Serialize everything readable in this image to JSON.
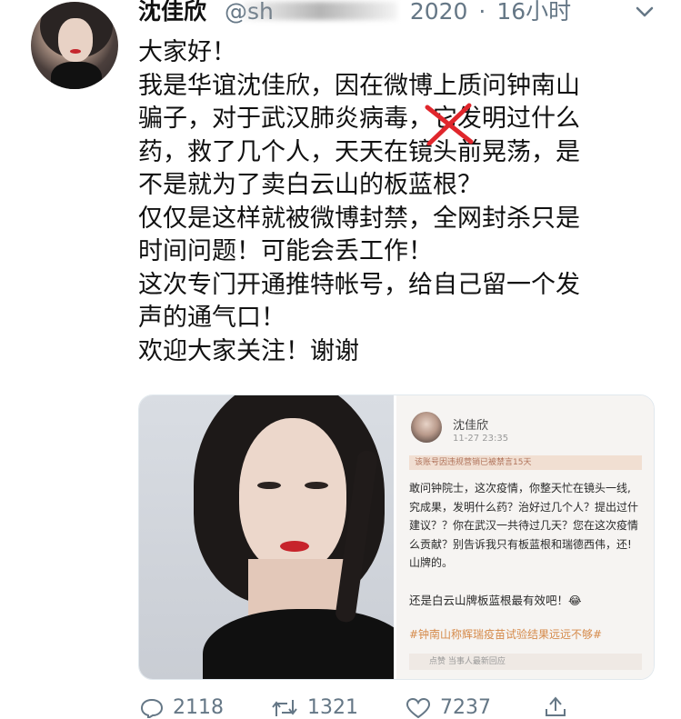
{
  "tweet": {
    "author_name": "沈佳欣",
    "handle": "@sh",
    "handle_tail": "2020",
    "separator": "·",
    "time": "16小时",
    "lines": [
      "大家好！",
      "我是华谊沈佳欣，因在微博上质问钟南山",
      "骗子，对于武汉肺炎病毒，它发明过什么",
      "药，救了几个人，天天在镜头前晃荡，是",
      "不是就为了卖白云山的板蓝根？",
      "仅仅是这样就被微博封禁，全网封杀只是",
      "时间问题！可能会丢工作！",
      "这次专门开通推特帐号，给自己留一个发",
      "声的通气口！",
      "欢迎大家关注！谢谢"
    ]
  },
  "embedded_post": {
    "name": "沈佳欣",
    "date": "11-27 23:35",
    "banner": "该账号因违规营销已被禁言15天",
    "body_lines": [
      "敢问钟院士，这次疫情，你整天忙在镜头一线,",
      "究成果，发明什么药？治好过几个人？提出过什",
      "建议？？你在武汉一共待过几天？您在这次疫情",
      "么贡献？别告诉我只有板蓝根和瑞德西伟，还!",
      "山牌的。"
    ],
    "quote": "还是白云山牌板蓝根最有效吧！😂",
    "hashtag": "#钟南山称辉瑞疫苗试验结果远远不够#",
    "footer": "点赞 当事人最新回应"
  },
  "actions": {
    "replies": "2118",
    "retweets": "1321",
    "likes": "7237"
  }
}
